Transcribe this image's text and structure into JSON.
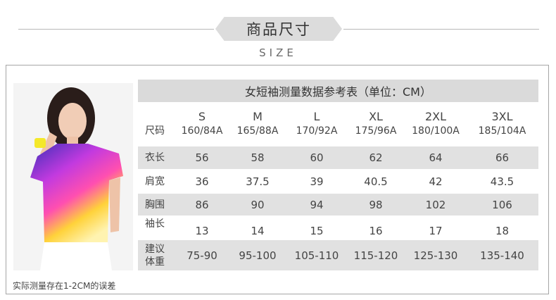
{
  "header": {
    "title": "商品尺寸",
    "subtitle": "SIZE"
  },
  "table": {
    "title": "女短袖测量数据参考表（单位：CM）",
    "size_label": "尺码",
    "sizes": [
      {
        "size": "S",
        "height": "160/84A"
      },
      {
        "size": "M",
        "height": "165/88A"
      },
      {
        "size": "L",
        "height": "170/92A"
      },
      {
        "size": "XL",
        "height": "175/96A"
      },
      {
        "size": "2XL",
        "height": "180/100A"
      },
      {
        "size": "3XL",
        "height": "185/104A"
      }
    ],
    "rows": [
      {
        "label": "衣长",
        "values": [
          "56",
          "58",
          "60",
          "62",
          "64",
          "66"
        ]
      },
      {
        "label": "肩宽",
        "values": [
          "36",
          "37.5",
          "39",
          "40.5",
          "42",
          "43.5"
        ]
      },
      {
        "label": "胸围",
        "values": [
          "86",
          "90",
          "94",
          "98",
          "102",
          "106"
        ]
      },
      {
        "label": "袖长",
        "values": [
          "13",
          "14",
          "15",
          "16",
          "17",
          "18"
        ]
      }
    ],
    "weight_row": {
      "label_line1": "建议",
      "label_line2": "体重",
      "values": [
        "75-90",
        "95-100",
        "105-110",
        "115-120",
        "125-130",
        "135-140"
      ]
    }
  },
  "caption": "实际测量存在1-2CM的误差",
  "colors": {
    "shade": "#e1e1e1",
    "title_bg": "#dadada",
    "border": "#a5a5a5"
  }
}
